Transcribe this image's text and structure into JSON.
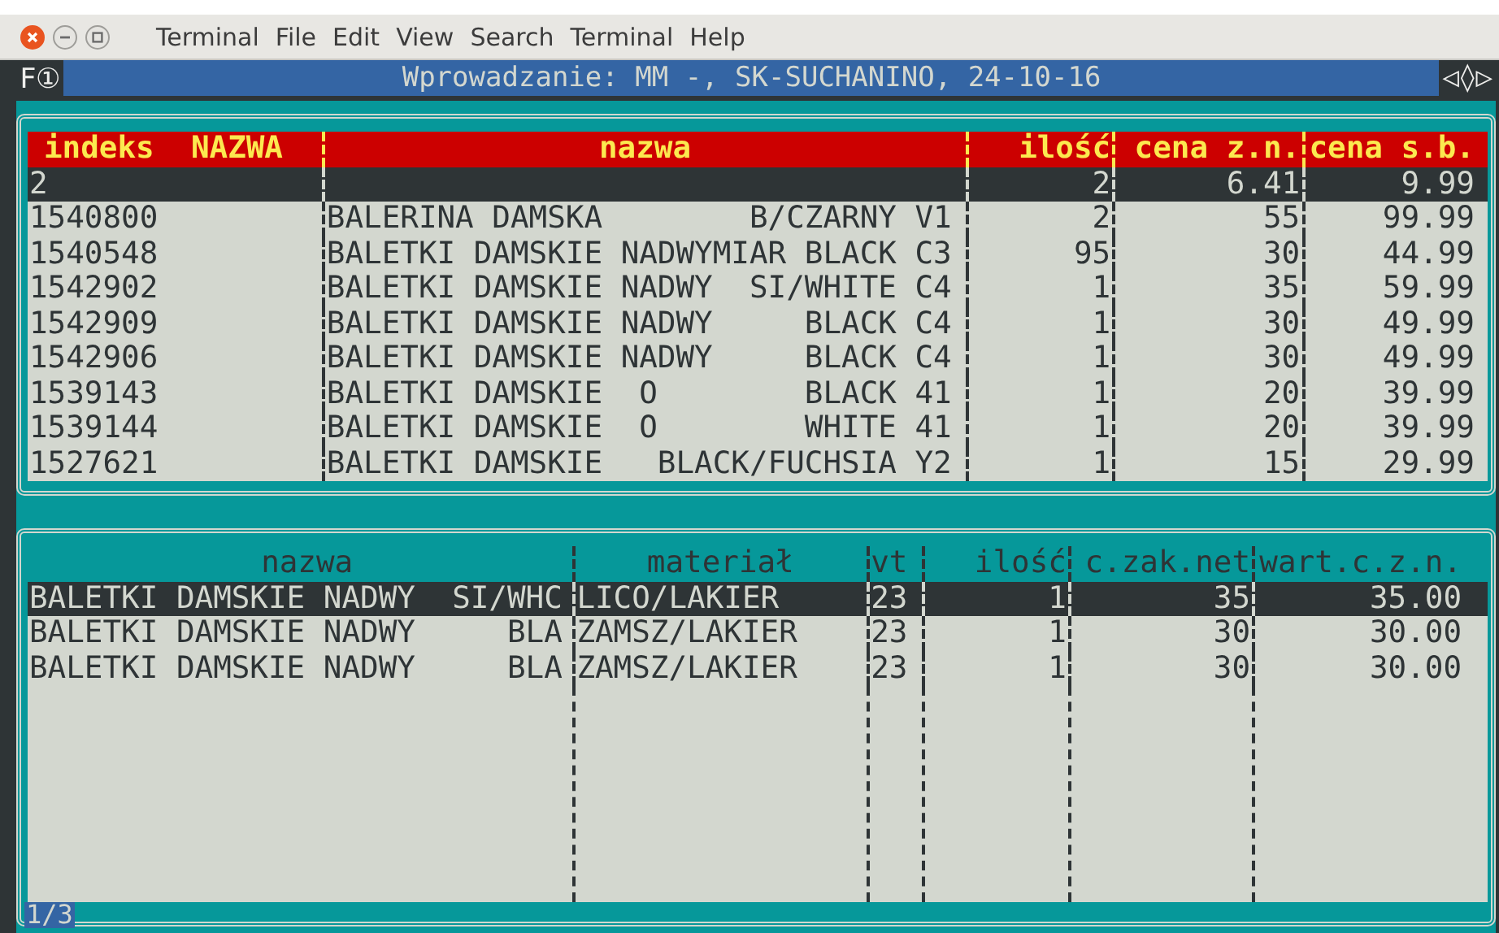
{
  "window": {
    "menu": [
      "Terminal",
      "File",
      "Edit",
      "View",
      "Search",
      "Terminal",
      "Help"
    ]
  },
  "terminal_bar": {
    "left": "F①",
    "title": "Wprowadzanie: MM -, SK-SUCHANINO, 24-10-16",
    "right": "◁◊▷"
  },
  "top_table": {
    "columns": [
      "indeks  NAZWA",
      "nazwa",
      "ilość",
      "cena z.n.",
      "cena s.b."
    ],
    "rows": [
      {
        "selected": true,
        "cells": [
          "2",
          null,
          "2",
          "6.41",
          "9.99"
        ]
      },
      {
        "selected": false,
        "cells": [
          "1540800",
          "BALERINA DAMSKA        B/CZARNY V1",
          "2",
          "55",
          "99.99"
        ]
      },
      {
        "selected": false,
        "cells": [
          "1540548",
          "BALETKI DAMSKIE NADWYMIAR BLACK C3",
          "95",
          "30",
          "44.99"
        ]
      },
      {
        "selected": false,
        "cells": [
          "1542902",
          "BALETKI DAMSKIE NADWY  SI/WHITE C4",
          "1",
          "35",
          "59.99"
        ]
      },
      {
        "selected": false,
        "cells": [
          "1542909",
          "BALETKI DAMSKIE NADWY     BLACK C4",
          "1",
          "30",
          "49.99"
        ]
      },
      {
        "selected": false,
        "cells": [
          "1542906",
          "BALETKI DAMSKIE NADWY     BLACK C4",
          "1",
          "30",
          "49.99"
        ]
      },
      {
        "selected": false,
        "cells": [
          "1539143",
          "BALETKI DAMSKIE  O        BLACK 41",
          "1",
          "20",
          "39.99"
        ]
      },
      {
        "selected": false,
        "cells": [
          "1539144",
          "BALETKI DAMSKIE  O        WHITE 41",
          "1",
          "20",
          "39.99"
        ]
      },
      {
        "selected": false,
        "cells": [
          "1527621",
          "BALETKI DAMSKIE   BLACK/FUCHSIA Y2",
          "1",
          "15",
          "29.99"
        ]
      }
    ]
  },
  "bottom_table": {
    "columns": [
      "nazwa",
      "materiał",
      "vt",
      "ilość",
      "c.zak.net",
      "wart.c.z.n."
    ],
    "rows": [
      {
        "selected": true,
        "cells": [
          "BALETKI DAMSKIE NADWY  SI/WHC",
          "LICO/LAKIER",
          "23",
          "1",
          "35",
          "35.00"
        ]
      },
      {
        "selected": false,
        "cells": [
          "BALETKI DAMSKIE NADWY     BLA",
          "ZAMSZ/LAKIER",
          "23",
          "1",
          "30",
          "30.00"
        ]
      },
      {
        "selected": false,
        "cells": [
          "BALETKI DAMSKIE NADWY     BLA",
          "ZAMSZ/LAKIER",
          "23",
          "1",
          "30",
          "30.00"
        ]
      }
    ]
  },
  "pager": "1/3"
}
